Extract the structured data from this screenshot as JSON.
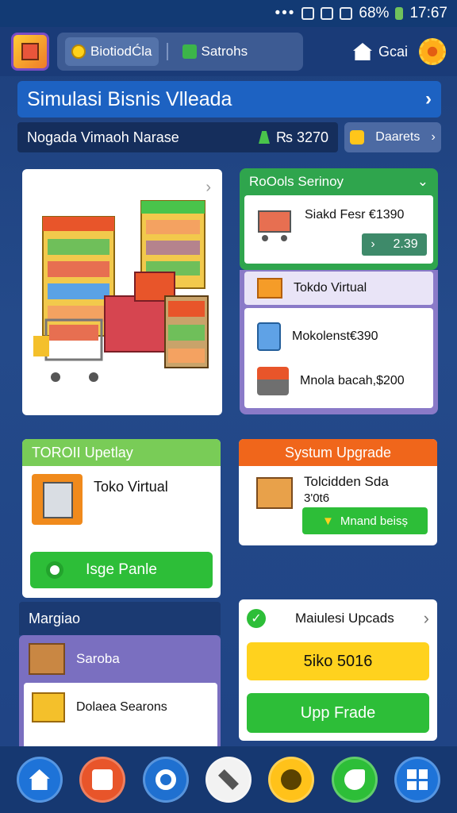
{
  "status_bar": {
    "dots": "•••",
    "battery": "68%",
    "time": "17:67"
  },
  "app_bar": {
    "tabs": [
      {
        "label": "BiotiodĆla"
      },
      {
        "label": "Satrohs"
      }
    ],
    "account_label": "Gcai"
  },
  "title_bar": {
    "title": "Simulasi Bisnis Vlleada"
  },
  "sub_bar": {
    "name": "Nogada Vimaoh Narase",
    "value": "₨ 3270"
  },
  "details_button": {
    "label": "Daarets"
  },
  "store_panel": {
    "header": "RoOols Serinoy",
    "item": {
      "label": "Siakd Fesr €1390",
      "price": "2.39"
    }
  },
  "virtual_panel": {
    "header": "Tokdo Virtual",
    "rows": [
      {
        "label": "Mokolenst€390"
      },
      {
        "label": "Mnola bacah,$200"
      }
    ]
  },
  "update_card": {
    "header": "TOROII Upetlay",
    "label": "Toko Virtual",
    "button": "Isge Panle"
  },
  "margin_panel": {
    "header": "Margiao",
    "row1": "Saroba",
    "row2": "Dolaea Searons"
  },
  "system_card": {
    "header": "Systum Upgrade",
    "line1": "Tolcidden Sda",
    "line2": "3'0t6",
    "button": "Mnand beisș"
  },
  "module_card": {
    "header": "Maiulesi Upcads",
    "price": "5iko 5016",
    "button": "Upp Frade"
  },
  "colors": {
    "accent_blue": "#1d62c2",
    "green": "#2dbe38",
    "orange": "#f0661b",
    "yellow": "#ffd21e",
    "purple": "#7a6fc0"
  },
  "bottom_nav": {
    "items": [
      {
        "icon": "home-icon",
        "color": "#1e73d8"
      },
      {
        "icon": "can-icon",
        "color": "#e8552a"
      },
      {
        "icon": "gear-icon",
        "color": "#1f70d0"
      },
      {
        "icon": "wrench-icon",
        "color": "#f2f2f2"
      },
      {
        "icon": "key-icon",
        "color": "#ffc21a"
      },
      {
        "icon": "phone-icon",
        "color": "#2dbe38"
      },
      {
        "icon": "grid-icon",
        "color": "#1e73d8"
      }
    ]
  }
}
